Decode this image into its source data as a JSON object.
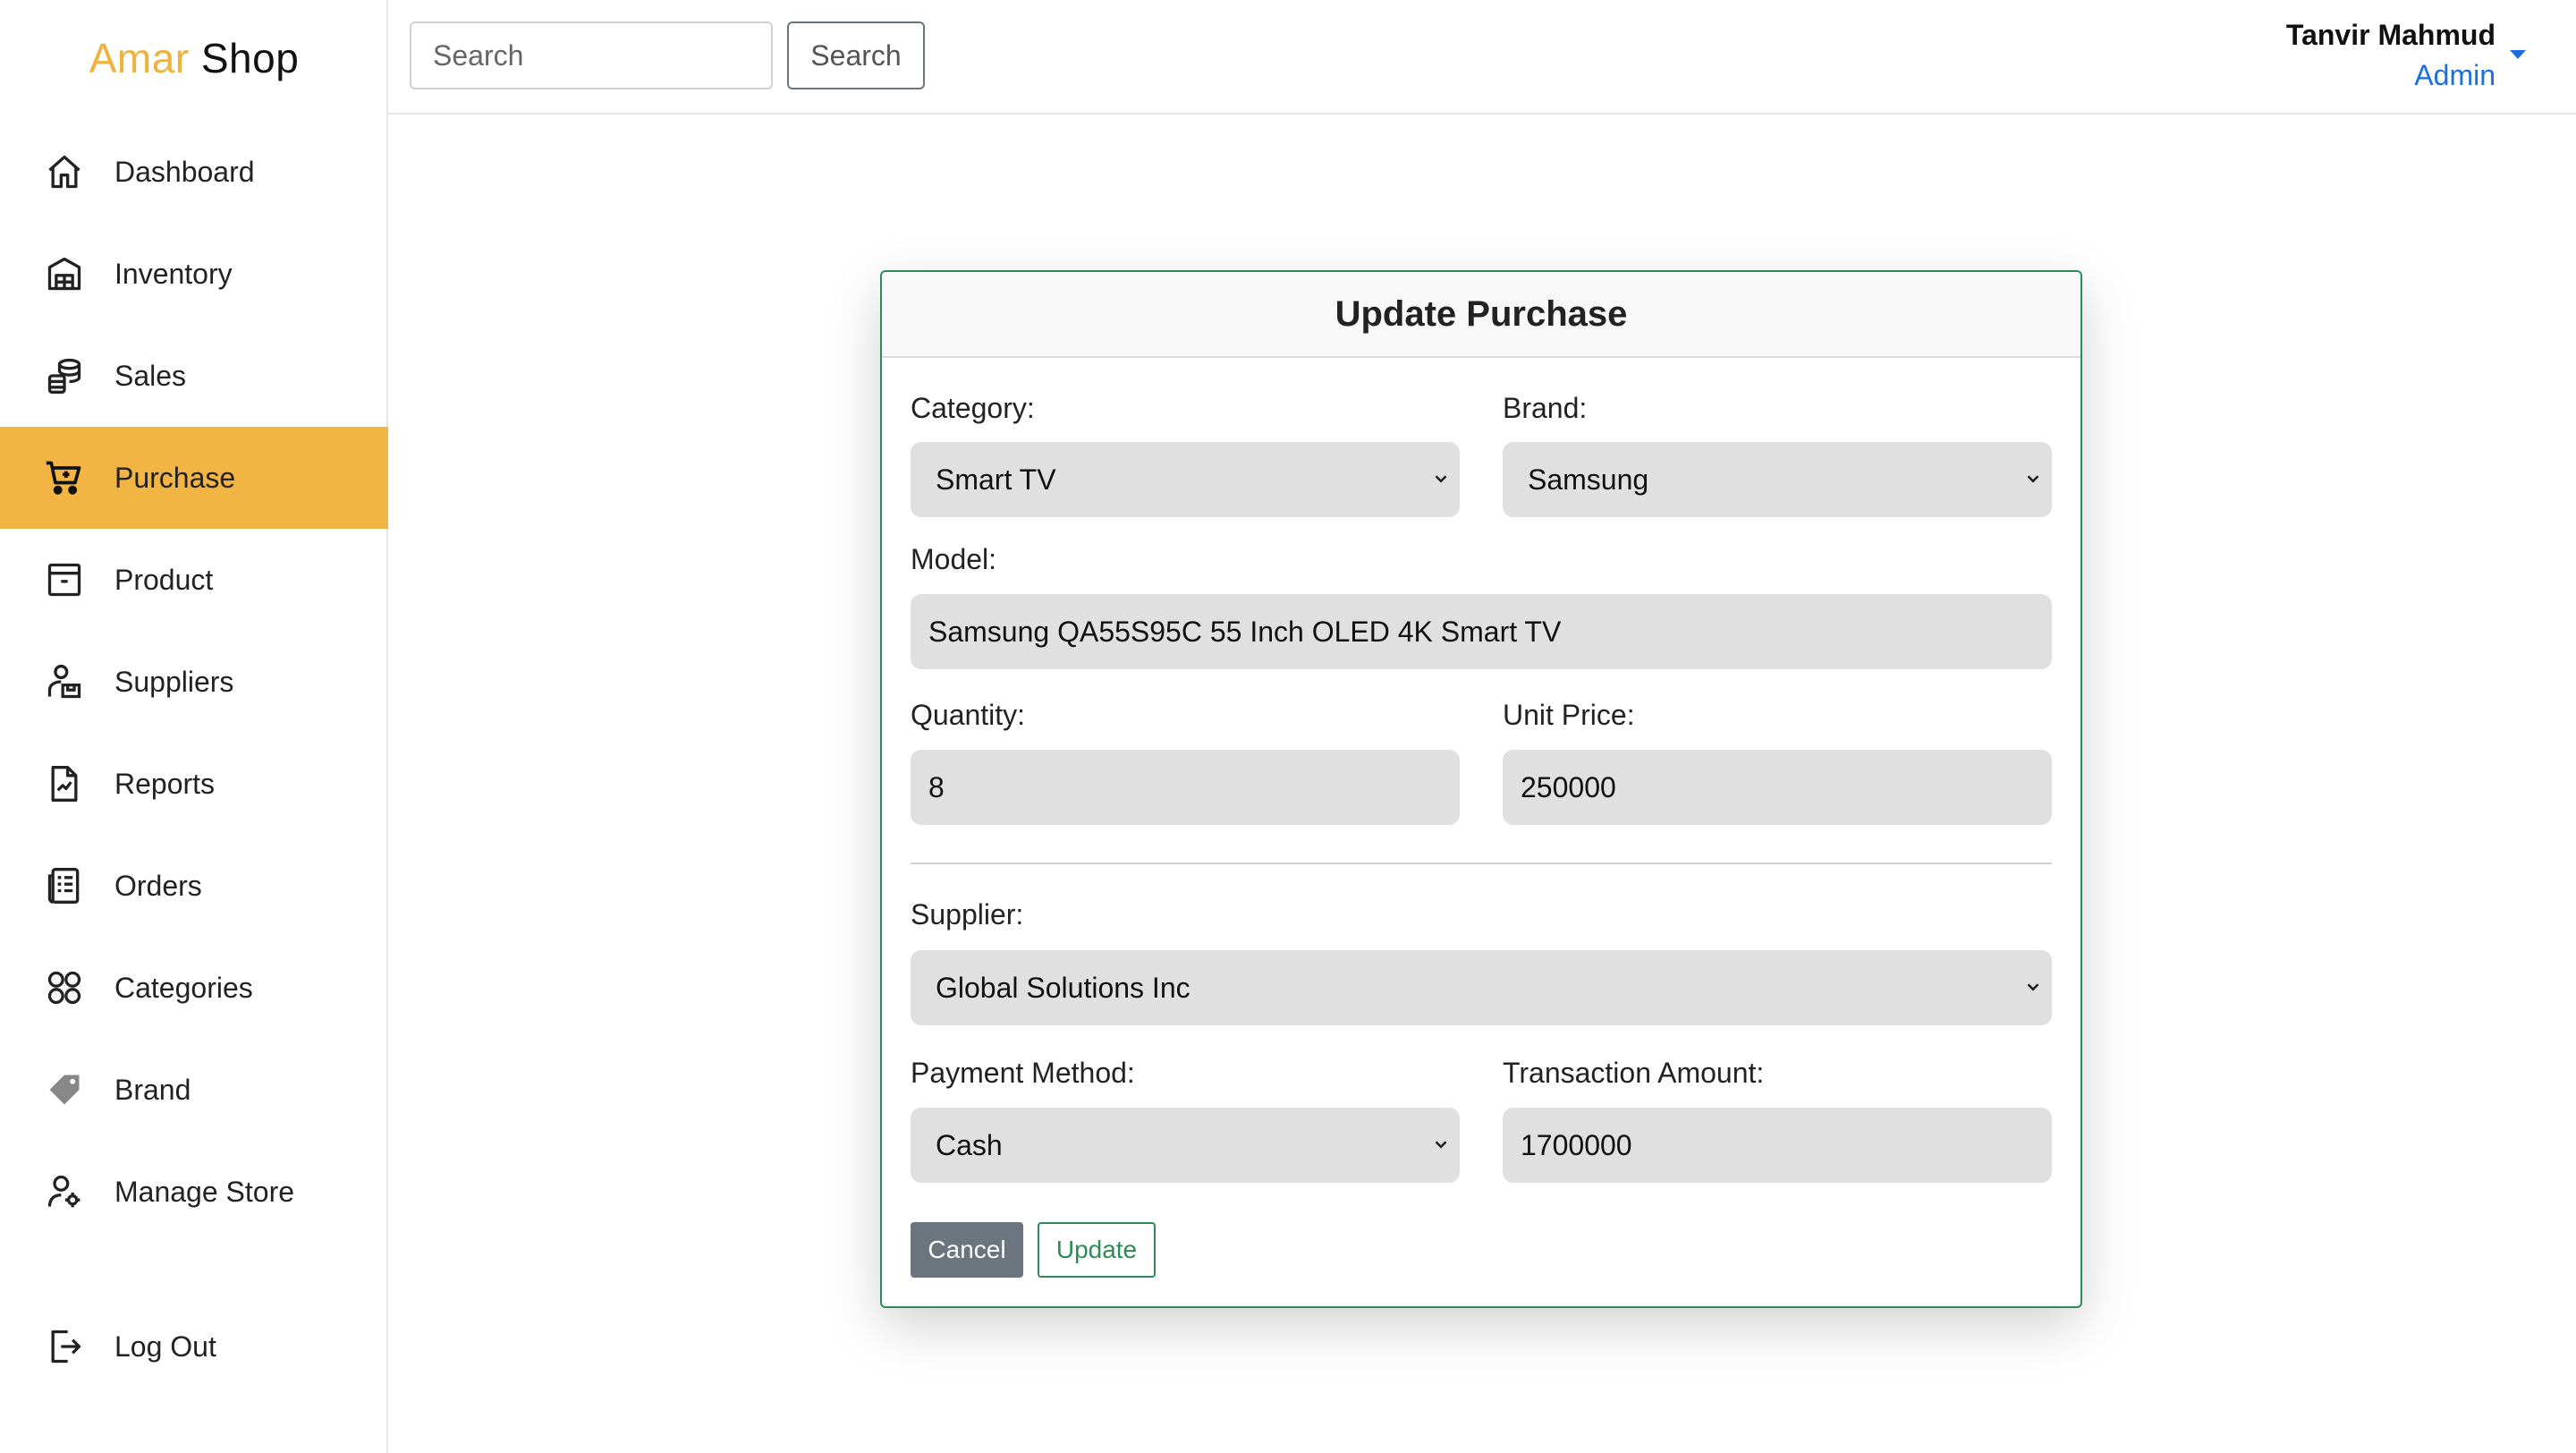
{
  "brand": {
    "part1": "Amar",
    "part2": "Shop"
  },
  "sidebar": {
    "items": [
      {
        "label": "Dashboard",
        "icon": "home-icon"
      },
      {
        "label": "Inventory",
        "icon": "warehouse-icon"
      },
      {
        "label": "Sales",
        "icon": "coins-icon"
      },
      {
        "label": "Purchase",
        "icon": "cart-icon",
        "active": true
      },
      {
        "label": "Product",
        "icon": "archive-icon"
      },
      {
        "label": "Suppliers",
        "icon": "supplier-icon"
      },
      {
        "label": "Reports",
        "icon": "report-icon"
      },
      {
        "label": "Orders",
        "icon": "orders-icon"
      },
      {
        "label": "Categories",
        "icon": "categories-icon"
      },
      {
        "label": "Brand",
        "icon": "tag-icon"
      },
      {
        "label": "Manage Store",
        "icon": "user-gear-icon"
      }
    ],
    "logout": {
      "label": "Log Out",
      "icon": "logout-icon"
    }
  },
  "header": {
    "search_placeholder": "Search",
    "search_button": "Search",
    "user_name": "Tanvir Mahmud",
    "user_role": "Admin"
  },
  "modal": {
    "title": "Update Purchase",
    "category": {
      "label": "Category:",
      "value": "Smart TV"
    },
    "brand": {
      "label": "Brand:",
      "value": "Samsung"
    },
    "model": {
      "label": "Model:",
      "value": "Samsung QA55S95C 55 Inch OLED 4K Smart TV"
    },
    "quantity": {
      "label": "Quantity:",
      "value": "8"
    },
    "unit_price": {
      "label": "Unit Price:",
      "value": "250000"
    },
    "supplier": {
      "label": "Supplier:",
      "value": "Global Solutions Inc"
    },
    "payment_method": {
      "label": "Payment Method:",
      "value": "Cash"
    },
    "transaction_amount": {
      "label": "Transaction Amount:",
      "value": "1700000"
    },
    "cancel_button": "Cancel",
    "update_button": "Update"
  },
  "colors": {
    "accent": "#f2b544",
    "brand_amar": "#f0b23e",
    "modal_border": "#2e8b57",
    "link_blue": "#1a6fdc",
    "cancel_gray": "#6c757d"
  }
}
